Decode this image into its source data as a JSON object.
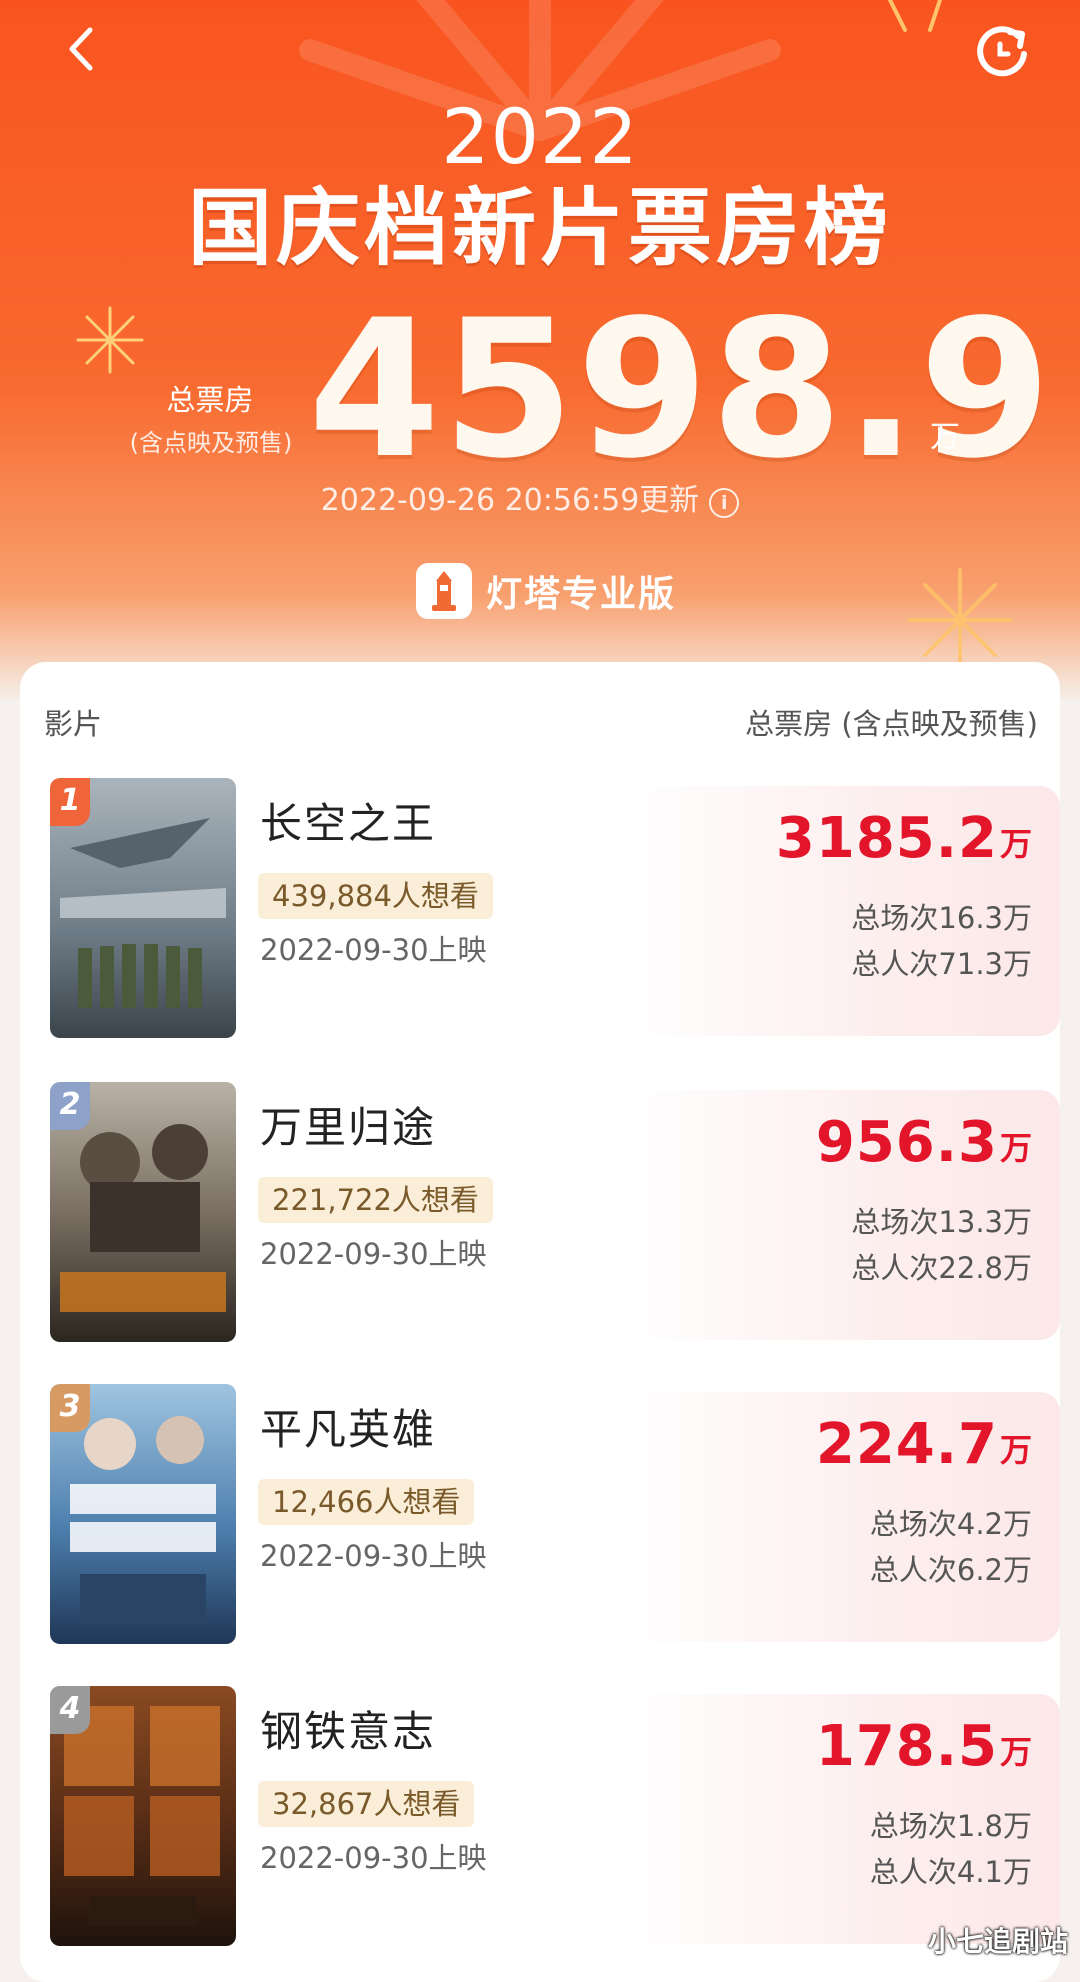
{
  "header": {
    "year": "2022",
    "title": "国庆档新片票房榜",
    "total_label": "总票房",
    "total_sub": "(含点映及预售)",
    "total_value": "4598.9",
    "total_unit": "万",
    "update_time": "2022-09-26 20:56:59更新",
    "brand_name": "灯塔专业版",
    "back_icon": "chevron-left-icon",
    "refresh_icon": "refresh-icon"
  },
  "table": {
    "col_film": "影片",
    "col_box": "总票房 (含点映及预售)"
  },
  "films": [
    {
      "rank": "1",
      "name": "长空之王",
      "want": "439,884人想看",
      "release": "2022-09-30上映",
      "box": "3185.2",
      "unit": "万",
      "shows": "总场次16.3万",
      "people": "总人次71.3万",
      "badge_color": "#f0643a"
    },
    {
      "rank": "2",
      "name": "万里归途",
      "want": "221,722人想看",
      "release": "2022-09-30上映",
      "box": "956.3",
      "unit": "万",
      "shows": "总场次13.3万",
      "people": "总人次22.8万",
      "badge_color": "#8ea1c8"
    },
    {
      "rank": "3",
      "name": "平凡英雄",
      "want": "12,466人想看",
      "release": "2022-09-30上映",
      "box": "224.7",
      "unit": "万",
      "shows": "总场次4.2万",
      "people": "总人次6.2万",
      "badge_color": "#d79a63"
    },
    {
      "rank": "4",
      "name": "钢铁意志",
      "want": "32,867人想看",
      "release": "2022-09-30上映",
      "box": "178.5",
      "unit": "万",
      "shows": "总场次1.8万",
      "people": "总人次4.1万",
      "badge_color": "#9a9a9a"
    }
  ],
  "watermark": "小七追剧站",
  "colors": {
    "header_orange": "#f9541f",
    "box_red": "#e3152b",
    "tag_bg": "#fbeed8"
  }
}
